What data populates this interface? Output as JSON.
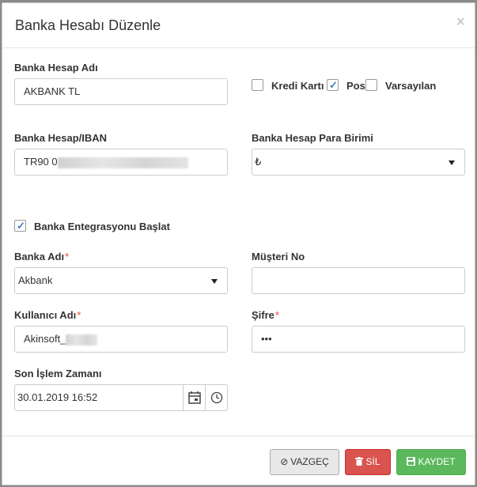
{
  "modal": {
    "title": "Banka Hesabı Düzenle",
    "close_label": "×"
  },
  "form": {
    "account_name": {
      "label": "Banka Hesap Adı",
      "value": "AKBANK TL"
    },
    "credit_card": {
      "label": "Kredi Kartı",
      "checked": false
    },
    "pos": {
      "label": "Pos",
      "checked": true
    },
    "default": {
      "label": "Varsayılan",
      "checked": false
    },
    "iban": {
      "label": "Banka Hesap/IBAN",
      "value": "TR90 0"
    },
    "currency": {
      "label": "Banka Hesap Para Birimi",
      "value": "₺"
    },
    "integration": {
      "label": "Banka Entegrasyonu Başlat",
      "checked": true
    },
    "bank_name": {
      "label": "Banka Adı",
      "required_mark": "*",
      "value": "Akbank"
    },
    "customer_no": {
      "label": "Müşteri No",
      "value": ""
    },
    "username": {
      "label": "Kullanıcı Adı",
      "required_mark": "*",
      "value": "Akinsoft_"
    },
    "password": {
      "label": "Şifre",
      "required_mark": "*",
      "value": "•••"
    },
    "last_op_time": {
      "label": "Son İşlem Zamanı",
      "value": "30.01.2019 16:52"
    }
  },
  "icons": {
    "calendar": "calendar-icon",
    "clock": "clock-icon",
    "cancel": "ban-icon",
    "delete": "trash-icon",
    "save": "floppy-icon"
  },
  "buttons": {
    "cancel_label": "VAZGEÇ",
    "delete_label": "SİL",
    "save_label": "KAYDET"
  },
  "colors": {
    "danger": "#d9534f",
    "success": "#5cb85c",
    "check": "#3a7ec2",
    "required": "#e74c3c"
  }
}
